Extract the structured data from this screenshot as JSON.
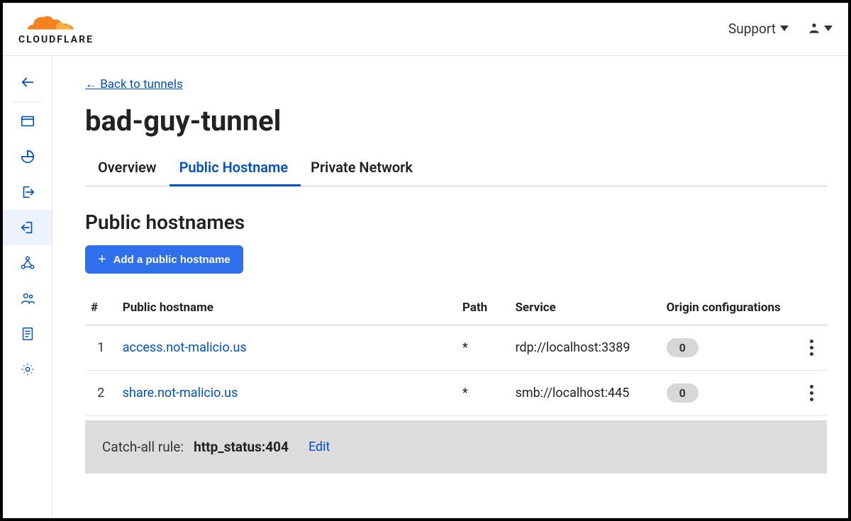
{
  "brand": {
    "name": "CLOUDFLARE"
  },
  "header": {
    "support_label": "Support"
  },
  "nav": {
    "back_label": "← Back to tunnels"
  },
  "page": {
    "title": "bad-guy-tunnel",
    "section_title": "Public hostnames",
    "add_button_label": "Add a public hostname"
  },
  "tabs": [
    {
      "label": "Overview",
      "active": false
    },
    {
      "label": "Public Hostname",
      "active": true
    },
    {
      "label": "Private Network",
      "active": false
    }
  ],
  "table": {
    "headers": {
      "num": "#",
      "hostname": "Public hostname",
      "path": "Path",
      "service": "Service",
      "origin": "Origin configurations"
    },
    "rows": [
      {
        "num": "1",
        "hostname": "access.not-malicio.us",
        "path": "*",
        "service": "rdp://localhost:3389",
        "origin": "0"
      },
      {
        "num": "2",
        "hostname": "share.not-malicio.us",
        "path": "*",
        "service": "smb://localhost:445",
        "origin": "0"
      }
    ]
  },
  "catchall": {
    "label": "Catch-all rule:",
    "value": "http_status:404",
    "edit_label": "Edit"
  }
}
